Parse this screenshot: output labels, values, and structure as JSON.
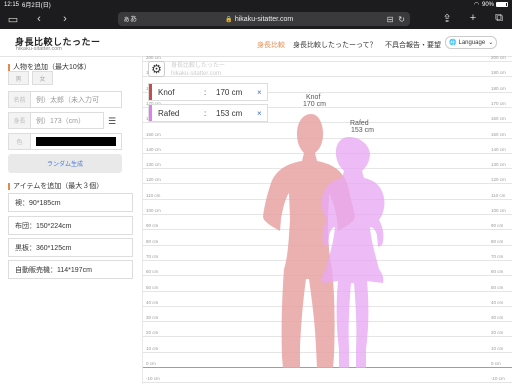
{
  "status": {
    "time": "12:15",
    "date": "6月2日(日)",
    "battery": "90%"
  },
  "browser": {
    "text_size": "ぁあ",
    "url": "hikaku-sitatter.com"
  },
  "site": {
    "logo": "身長比較したったー",
    "logo_sub": "hikaku-sitatter.com",
    "nav": [
      "身長比較",
      "身長比較したったーって？",
      "不具合報告・要望"
    ],
    "language": "Language"
  },
  "add_person": {
    "title": "人物を追加（最大10体）",
    "gender": [
      "男",
      "女"
    ],
    "name_label": "名前",
    "name_placeholder": "例）太郎（未入力可",
    "height_label": "身長",
    "height_placeholder": "例）173（cm）",
    "color_label": "色",
    "color_value": "#000000",
    "random_button": "ランダム生成"
  },
  "add_item": {
    "title": "アイテムを追加（最大３個）",
    "items": [
      "襖：90*185cm",
      "布団：150*224cm",
      "黒板：360*125cm",
      "自動販売機：114*197cm"
    ]
  },
  "chart": {
    "watermark_line1": "身長比較したったー",
    "watermark_line2": "hikaku-sitatter.com",
    "ticks": [
      "200 cm",
      "190 cm",
      "180 cm",
      "170 cm",
      "160 cm",
      "150 cm",
      "140 cm",
      "130 cm",
      "120 cm",
      "110 cm",
      "100 cm",
      "90 cm",
      "80 cm",
      "70 cm",
      "60 cm",
      "50 cm",
      "40 cm",
      "30 cm",
      "20 cm",
      "10 cm",
      "0 cm",
      "-10 cm"
    ],
    "persons": [
      {
        "name": "Knof",
        "height": "170 cm",
        "color": "#c0504d",
        "fig_color": "#e8a2a2"
      },
      {
        "name": "Rafed",
        "height": "153 cm",
        "color": "#e080f0",
        "fig_color": "#e8a8f4"
      }
    ]
  }
}
